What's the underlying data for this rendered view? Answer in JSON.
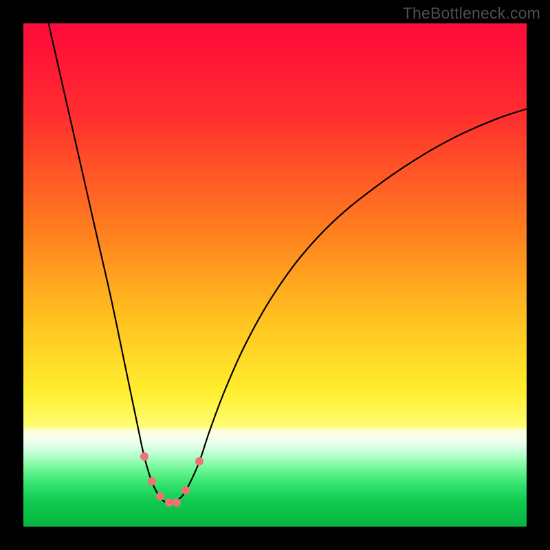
{
  "watermark": {
    "text": "TheBottleneck.com"
  },
  "chart_data": {
    "type": "line",
    "title": "",
    "xlabel": "",
    "ylabel": "",
    "xlim": [
      0,
      100
    ],
    "ylim": [
      0,
      100
    ],
    "gradient_stops": [
      {
        "offset": 0,
        "color": "#ff0a3a"
      },
      {
        "offset": 18,
        "color": "#ff2d2f"
      },
      {
        "offset": 40,
        "color": "#ff7a1f"
      },
      {
        "offset": 58,
        "color": "#ffbf1f"
      },
      {
        "offset": 73,
        "color": "#ffee2e"
      },
      {
        "offset": 80,
        "color": "#fffc70"
      },
      {
        "offset": 81,
        "color": "#fffde0"
      },
      {
        "offset": 82,
        "color": "#f9ffe8"
      },
      {
        "offset": 83,
        "color": "#effff0"
      },
      {
        "offset": 84,
        "color": "#deffe8"
      },
      {
        "offset": 86,
        "color": "#b0ffc7"
      },
      {
        "offset": 89,
        "color": "#63f58d"
      },
      {
        "offset": 92,
        "color": "#2de06b"
      },
      {
        "offset": 95,
        "color": "#0fca4f"
      },
      {
        "offset": 100,
        "color": "#06b53f"
      }
    ],
    "series": [
      {
        "name": "bottleneck-curve",
        "x": [
          5.0,
          7.5,
          10.0,
          12.5,
          15.0,
          17.5,
          20.0,
          22.5,
          24.0,
          25.5,
          27.0,
          28.0,
          29.0,
          30.0,
          31.5,
          33.0,
          35.0,
          37.0,
          40.0,
          44.0,
          49.0,
          55.0,
          62.0,
          70.0,
          78.0,
          86.0,
          94.0,
          100.0
        ],
        "y": [
          100.0,
          89.0,
          78.0,
          67.0,
          56.0,
          45.0,
          33.0,
          21.0,
          14.0,
          9.0,
          6.0,
          5.0,
          4.8,
          5.0,
          6.0,
          8.5,
          13.0,
          19.0,
          27.0,
          36.0,
          45.0,
          53.5,
          61.0,
          67.5,
          73.0,
          77.5,
          81.0,
          83.0
        ]
      }
    ],
    "markers": {
      "name": "highlight-points",
      "color": "#f07272",
      "points": [
        {
          "x": 24.0,
          "y": 14.0
        },
        {
          "x": 25.6,
          "y": 9.0
        },
        {
          "x": 27.2,
          "y": 6.0
        },
        {
          "x": 28.9,
          "y": 4.8
        },
        {
          "x": 30.5,
          "y": 4.8
        },
        {
          "x": 32.2,
          "y": 7.2
        },
        {
          "x": 35.0,
          "y": 13.0
        }
      ]
    }
  }
}
